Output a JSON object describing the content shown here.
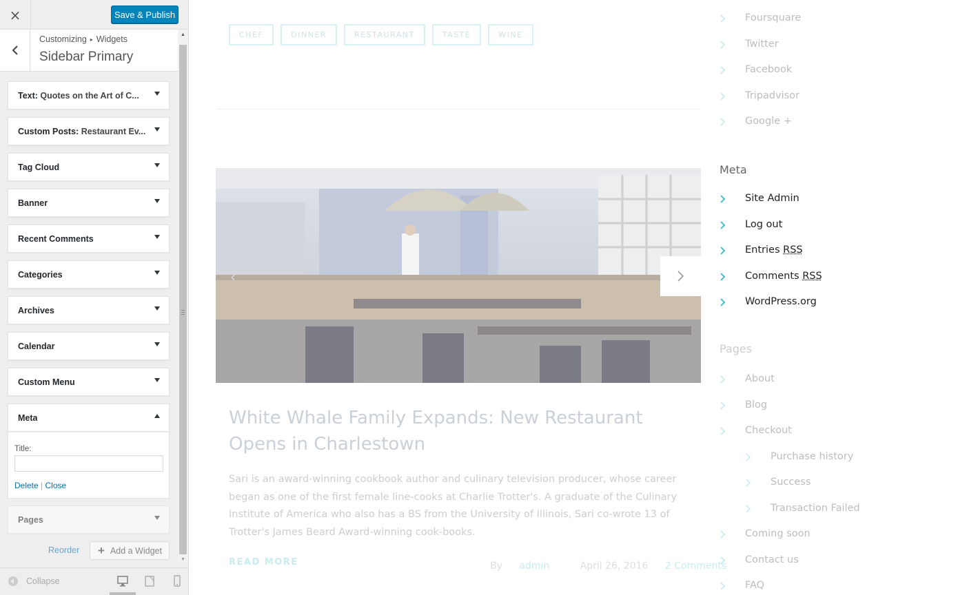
{
  "customizer": {
    "close_icon": "×",
    "save_label": "Save & Publish",
    "breadcrumb": {
      "root": "Customizing",
      "separator": "▸",
      "current": "Widgets"
    },
    "section_title": "Sidebar Primary",
    "widgets": [
      {
        "type": "Text",
        "in_widget_title": "Quotes on the Art of C..."
      },
      {
        "type": "Custom Posts",
        "in_widget_title": "Restaurant Ev..."
      },
      {
        "type": "Tag Cloud"
      },
      {
        "type": "Banner"
      },
      {
        "type": "Recent Comments"
      },
      {
        "type": "Categories"
      },
      {
        "type": "Archives"
      },
      {
        "type": "Calendar"
      },
      {
        "type": "Custom Menu"
      },
      {
        "type": "Meta",
        "state": "expanded"
      },
      {
        "type": "Pages"
      }
    ],
    "meta_form": {
      "title_label": "Title:",
      "title_value": "",
      "delete_label": "Delete",
      "separator": "|",
      "close_label": "Close"
    },
    "reorder_label": "Reorder",
    "add_widget_label": "Add a Widget",
    "collapse_label": "Collapse",
    "devices": [
      "desktop",
      "tablet",
      "mobile"
    ],
    "active_device": "desktop",
    "accent_color": "#0085ba"
  },
  "preview": {
    "tags": [
      "CHEF",
      "DINNER",
      "RESTAURANT",
      "TASTE",
      "WINE"
    ],
    "post": {
      "title": "White Whale Family Expands: New Restaurant Opens in Charlestown",
      "excerpt": "Sari is an award-winning cookbook author and culinary television producer, whose career began as one of the first female line-cooks at Charlie Trotter's. A graduate of the Culinary Institute of America who also has a BS from the University of Illinois, Sari co-wrote 13 of Trotter's James Beard Award-winning cook-books.",
      "read_more": "READ MORE",
      "by_label": "By",
      "author": "admin",
      "date": "April 26, 2016",
      "comments": "2 Comments"
    },
    "social_links": [
      "Foursquare",
      "Twitter",
      "Facebook",
      "Tripadvisor",
      "Google +"
    ],
    "meta_widget": {
      "heading": "Meta",
      "links": [
        "Site Admin",
        "Log out",
        "Entries",
        "Comments",
        "WordPress.org"
      ],
      "rss_abbr": "RSS"
    },
    "pages_widget": {
      "heading": "Pages",
      "links": [
        "About",
        "Blog",
        "Checkout"
      ],
      "sub_links": [
        "Purchase history",
        "Success",
        "Transaction Failed"
      ],
      "more_links": [
        "Coming soon",
        "Contact us",
        "FAQ"
      ]
    },
    "accent_color": "#59c6cc"
  }
}
